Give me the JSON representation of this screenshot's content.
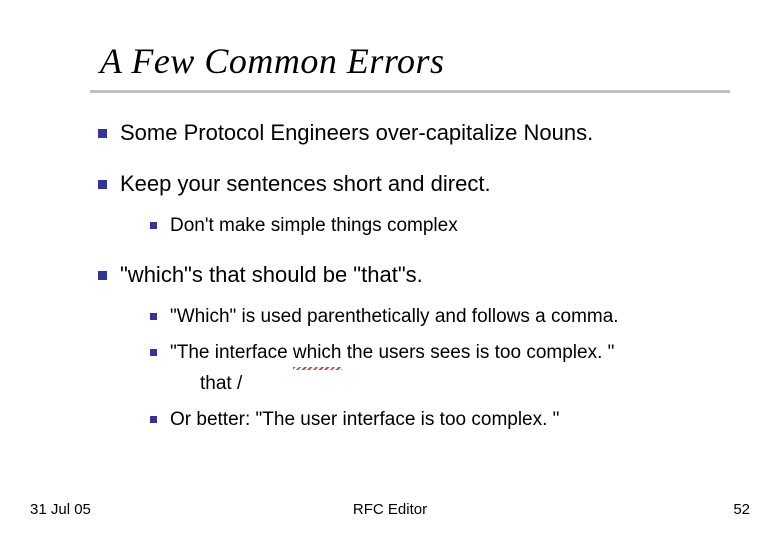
{
  "title": "A Few Common Errors",
  "items": [
    {
      "text": "Some Protocol Engineers over-capitalize Nouns."
    },
    {
      "text": "Keep your sentences short and direct.",
      "sub": [
        {
          "text": "Don't make simple things complex"
        }
      ]
    },
    {
      "text": "\"which\"s that should be \"that\"s.",
      "sub": [
        {
          "text": "\"Which\" is used parenthetically and follows a comma."
        },
        {
          "before": "\"The interface ",
          "wave": "which",
          "after": " the users sees is too complex. \"",
          "below": "that /"
        },
        {
          "text": "Or better: \"The user interface is too complex. \""
        }
      ]
    }
  ],
  "footer": {
    "date": "31 Jul 05",
    "center": "RFC Editor",
    "num": "52"
  }
}
